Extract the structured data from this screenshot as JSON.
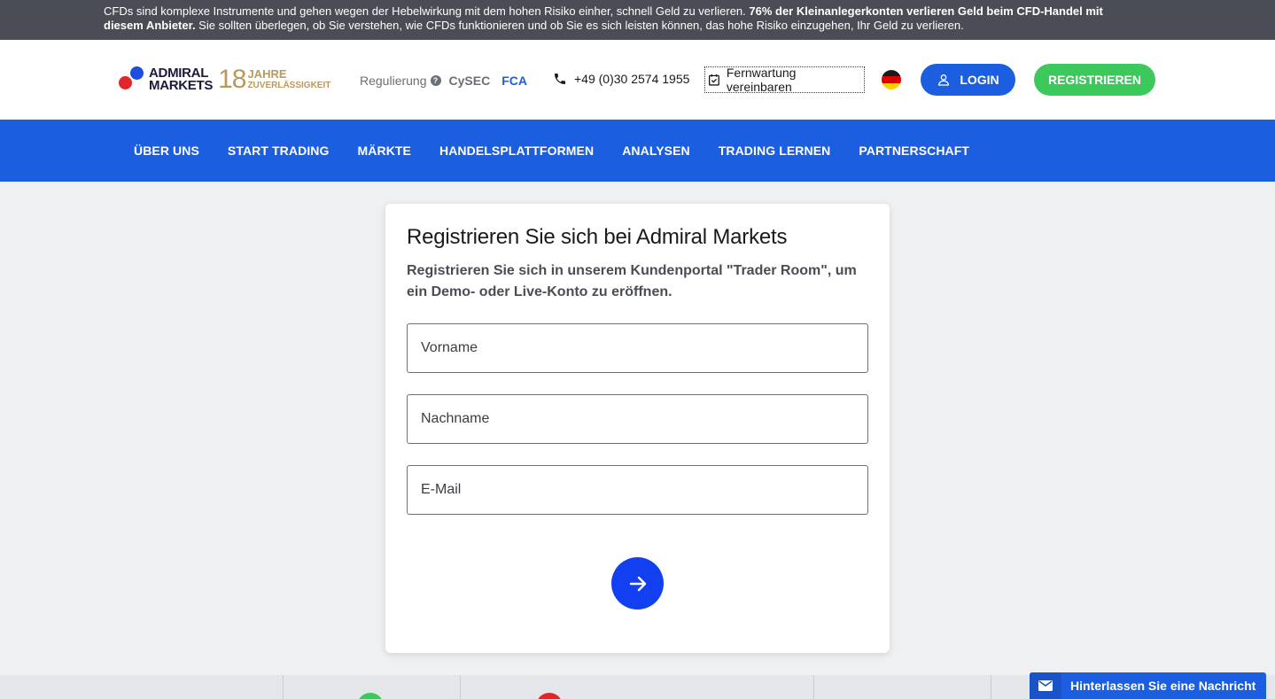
{
  "risk_banner": {
    "text_start": "CFDs sind komplexe Instrumente und gehen wegen der Hebelwirkung mit dem hohen Risiko einher, schnell Geld zu verlieren. ",
    "text_bold": "76% der Kleinanlegerkonten verlieren Geld beim CFD-Handel mit diesem Anbieter.",
    "text_end": " Sie sollten überlegen, ob Sie verstehen, wie CFDs funktionieren und ob Sie es sich leisten können, das hohe Risiko einzugehen, Ihr Geld zu verlieren."
  },
  "header": {
    "logo_line1": "ADMIRAL",
    "logo_line2": "MARKETS",
    "logo_years": "18",
    "logo_jahre": "JAHRE",
    "logo_zuverlaessigkeit": "ZUVERLÄSSIGKEIT",
    "regulation_label": "Regulierung",
    "regulation_help": "?",
    "regulator_1": "CySEC",
    "regulator_2": "FCA",
    "phone": "+49 (0)30 2574 1955",
    "remote_label": "Fernwartung vereinbaren",
    "login_label": "LOGIN",
    "register_label": "REGISTRIEREN",
    "colors": {
      "primary": "#1c5ee0",
      "register": "#3cc85a",
      "banner": "#4a4d55"
    }
  },
  "nav": {
    "items": [
      {
        "label": "ÜBER UNS"
      },
      {
        "label": "START TRADING"
      },
      {
        "label": "MÄRKTE"
      },
      {
        "label": "HANDELSPLATTFORMEN"
      },
      {
        "label": "ANALYSEN"
      },
      {
        "label": "TRADING LERNEN"
      },
      {
        "label": "PARTNERSCHAFT"
      }
    ]
  },
  "form": {
    "title": "Registrieren Sie sich bei Admiral Markets",
    "intro": "Registrieren Sie sich in unserem Kundenportal \"Trader Room\", um ein Demo- oder Live-Konto zu eröffnen.",
    "first_name_placeholder": "Vorname",
    "last_name_placeholder": "Nachname",
    "email_placeholder": "E-Mail",
    "submit_icon": "arrow-right-icon"
  },
  "chat": {
    "label": "Hinterlassen Sie eine Nachricht",
    "icon": "envelope-icon"
  }
}
